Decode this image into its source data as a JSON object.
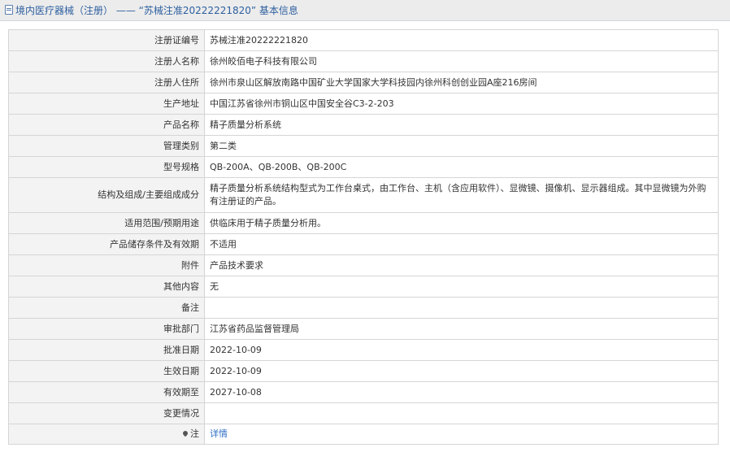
{
  "header": {
    "category": "境内医疗器械（注册）",
    "separator": "——",
    "title_quote": "“苏械注准20222221820”",
    "suffix": "基本信息"
  },
  "rows": [
    {
      "label": "注册证编号",
      "value": "苏械注准20222221820"
    },
    {
      "label": "注册人名称",
      "value": "徐州皎佰电子科技有限公司"
    },
    {
      "label": "注册人住所",
      "value": "徐州市泉山区解放南路中国矿业大学国家大学科技园内徐州科创创业园A座216房间"
    },
    {
      "label": "生产地址",
      "value": "中国江苏省徐州市铜山区中国安全谷C3-2-203"
    },
    {
      "label": "产品名称",
      "value": "精子质量分析系统"
    },
    {
      "label": "管理类别",
      "value": "第二类"
    },
    {
      "label": "型号规格",
      "value": "QB-200A、QB-200B、QB-200C"
    },
    {
      "label": "结构及组成/主要组成成分",
      "value": "精子质量分析系统结构型式为工作台桌式，由工作台、主机（含应用软件）、显微镜、摄像机、显示器组成。其中显微镜为外购有注册证的产品。"
    },
    {
      "label": "适用范围/预期用途",
      "value": "供临床用于精子质量分析用。"
    },
    {
      "label": "产品储存条件及有效期",
      "value": "不适用"
    },
    {
      "label": "附件",
      "value": "产品技术要求"
    },
    {
      "label": "其他内容",
      "value": "无"
    },
    {
      "label": "备注",
      "value": ""
    },
    {
      "label": "审批部门",
      "value": "江苏省药品监督管理局"
    },
    {
      "label": "批准日期",
      "value": "2022-10-09"
    },
    {
      "label": "生效日期",
      "value": "2022-10-09"
    },
    {
      "label": "有效期至",
      "value": "2027-10-08"
    },
    {
      "label": "变更情况",
      "value": ""
    }
  ],
  "note": {
    "label": "注",
    "link": "详情",
    "icon": "pin-icon"
  },
  "colors": {
    "link": "#2f6fc4",
    "title": "#2d5fa0",
    "label_bg": "#f3f3f3",
    "border": "#d5d5d5"
  }
}
